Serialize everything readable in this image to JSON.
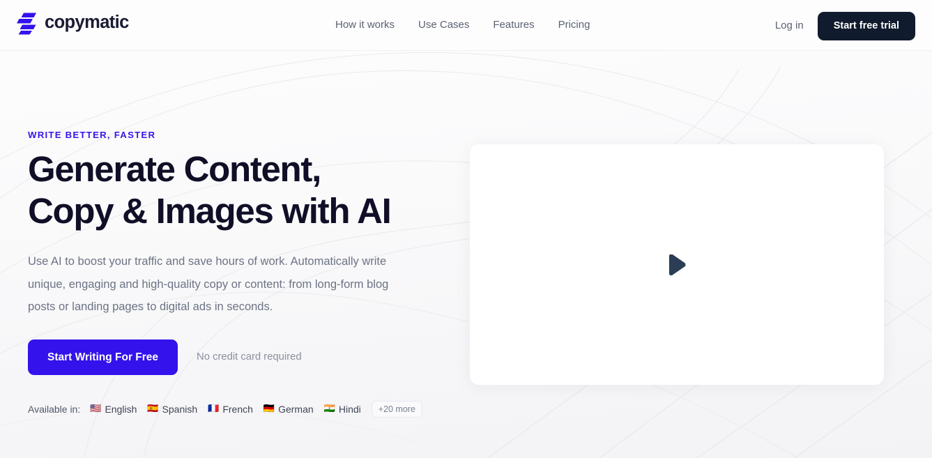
{
  "header": {
    "brand_name": "copymatic",
    "brand_mark_icon": "copymatic-logo-icon",
    "nav": [
      {
        "label": "How it works"
      },
      {
        "label": "Use Cases"
      },
      {
        "label": "Features"
      },
      {
        "label": "Pricing"
      }
    ],
    "login_label": "Log in",
    "trial_label": "Start free trial",
    "colors": {
      "trial_button_bg": "#101b2d",
      "brand_text": "#1b1b33",
      "brand_mark": "#3312ec",
      "nav_text": "#5c6273"
    }
  },
  "hero": {
    "eyebrow": "WRITE BETTER, FASTER",
    "title_line_1": "Generate Content,",
    "title_line_2": "Copy & Images with AI",
    "subtitle": "Use AI to boost your traffic and save hours of work. Automatically write unique, engaging and high-quality copy or content: from long-form blog posts or landing pages to digital ads in seconds.",
    "cta_label": "Start Writing For Free",
    "cta_note": "No credit card required",
    "colors": {
      "eyebrow": "#3717e8",
      "title": "#100f27",
      "subtitle": "#6c7384",
      "cta_bg": "#3312ec",
      "play_icon": "#2b3e56"
    },
    "languages": {
      "label": "Available in:",
      "items": [
        {
          "flag": "🇺🇸",
          "name": "English",
          "flag_icon": "flag-us-icon"
        },
        {
          "flag": "🇪🇸",
          "name": "Spanish",
          "flag_icon": "flag-es-icon"
        },
        {
          "flag": "🇫🇷",
          "name": "French",
          "flag_icon": "flag-fr-icon"
        },
        {
          "flag": "🇩🇪",
          "name": "German",
          "flag_icon": "flag-de-icon"
        },
        {
          "flag": "🇮🇳",
          "name": "Hindi",
          "flag_icon": "flag-in-icon"
        }
      ],
      "more_label": "+20 more"
    },
    "video": {
      "play_icon": "play-triangle-icon"
    }
  }
}
